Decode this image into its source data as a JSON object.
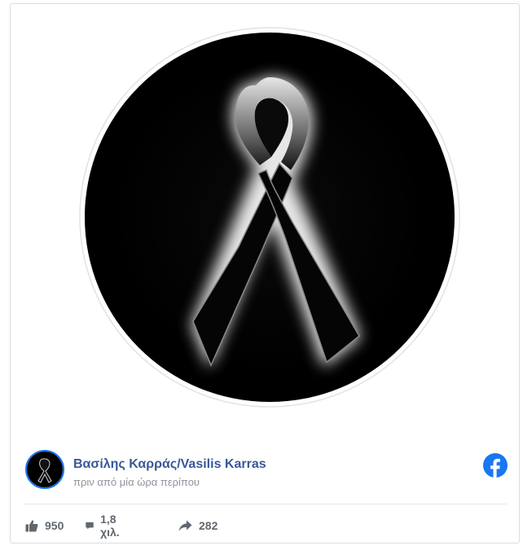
{
  "post": {
    "author": "Βασίλης Καρράς/Vasilis Karras",
    "timestamp": "πριν από μία ώρα περίπου",
    "image_icon": "black-mourning-ribbon",
    "avatar_icon": "black-mourning-ribbon",
    "platform_icon": "facebook-logo"
  },
  "stats": {
    "likes": "950",
    "comments": "1,8 χιλ.",
    "shares": "282",
    "like_icon": "thumbs-up-icon",
    "comment_icon": "comment-bubble-icon",
    "share_icon": "share-arrow-icon"
  },
  "colors": {
    "author_link": "#385898",
    "facebook_blue": "#1877f2",
    "meta_text": "#90949c",
    "stat_text": "#606770"
  }
}
